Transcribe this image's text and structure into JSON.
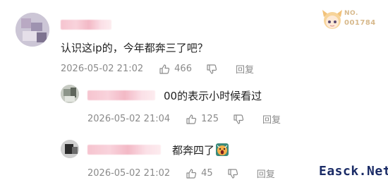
{
  "comments": [
    {
      "text": "认识这ip的，今年都奔三了吧？",
      "time": "2026-05-02 21:02",
      "likes": "466",
      "reply_label": "回复"
    },
    {
      "text": "00的表示小时候看过",
      "time": "2026-05-02 21:04",
      "likes": "125",
      "reply_label": "回复"
    },
    {
      "text": "都奔四了",
      "emoji_icon": "scream-emoji-icon",
      "time": "2026-05-02 21:02",
      "likes": "45",
      "reply_label": "回复"
    }
  ],
  "badge": {
    "prefix": "NO.",
    "number": "001784"
  },
  "watermark": "Easck.Net",
  "icons": [
    "thumbs-up-icon",
    "thumbs-down-icon"
  ],
  "colors": {
    "meta_text": "#8a8a8a",
    "badge_gold": "#d7b98c",
    "watermark": "#1a2b66"
  }
}
